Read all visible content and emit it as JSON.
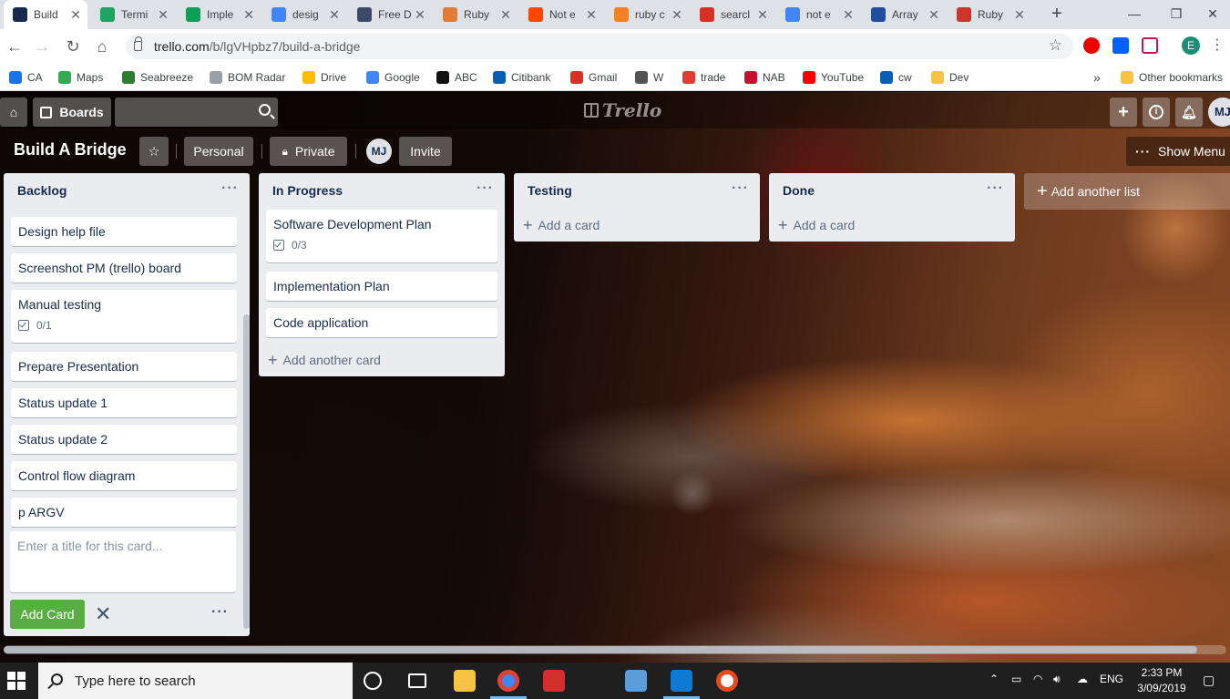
{
  "browser": {
    "tabs": [
      {
        "title": "Build",
        "color": "#172b4d",
        "active": true
      },
      {
        "title": "Termi",
        "color": "#1fa463"
      },
      {
        "title": "Imple",
        "color": "#0f9d58"
      },
      {
        "title": "desig",
        "color": "#4285f4"
      },
      {
        "title": "Free D",
        "color": "#3b4a6b"
      },
      {
        "title": "Ruby",
        "color": "#e07b39"
      },
      {
        "title": "Not e",
        "color": "#ff4500"
      },
      {
        "title": "ruby c",
        "color": "#f48024"
      },
      {
        "title": "searcl",
        "color": "#d93025"
      },
      {
        "title": "not e",
        "color": "#4285f4"
      },
      {
        "title": "Array",
        "color": "#1f4e9c"
      },
      {
        "title": "Ruby",
        "color": "#cc342d"
      }
    ],
    "new_tab": "+",
    "url_domain": "trello.com",
    "url_path": "/b/lgVHpbz7/build-a-bridge",
    "profile_initial": "E",
    "bookmarks": [
      {
        "label": "CA",
        "color": "#1a73e8"
      },
      {
        "label": "Maps",
        "color": "#34a853"
      },
      {
        "label": "Seabreeze",
        "color": "#2e7d32"
      },
      {
        "label": "BOM Radar",
        "color": "#9aa0a6"
      },
      {
        "label": "Drive",
        "color": "#fbbc04"
      },
      {
        "label": "Google",
        "color": "#4285f4"
      },
      {
        "label": "ABC",
        "color": "#111111"
      },
      {
        "label": "Citibank",
        "color": "#0b5fb3"
      },
      {
        "label": "Gmail",
        "color": "#d93025"
      },
      {
        "label": "W",
        "color": "#555555"
      },
      {
        "label": "trade",
        "color": "#e53935"
      },
      {
        "label": "NAB",
        "color": "#c8102e"
      },
      {
        "label": "YouTube",
        "color": "#ff0000"
      },
      {
        "label": "cw",
        "color": "#0b5fb3"
      },
      {
        "label": "Dev",
        "color": "#f6c343"
      }
    ],
    "bookmarks_overflow": "»",
    "other_bookmarks": "Other bookmarks"
  },
  "trello": {
    "boards_label": "Boards",
    "logo_text": "Trello",
    "avatar_initials": "MJ",
    "board_title": "Build A Bridge",
    "team_label": "Personal",
    "visibility_label": "Private",
    "invite_label": "Invite",
    "show_menu_label": "Show Menu",
    "add_list_label": "Add another list",
    "lists": [
      {
        "title": "Backlog",
        "cards": [
          {
            "title": "Design help file"
          },
          {
            "title": "Screenshot PM (trello) board"
          },
          {
            "title": "Manual testing",
            "checklist": "0/1"
          },
          {
            "title": "Prepare Presentation"
          },
          {
            "title": "Status update 1"
          },
          {
            "title": "Status update 2"
          },
          {
            "title": "Control flow diagram"
          },
          {
            "title": "p ARGV"
          }
        ],
        "composer_placeholder": "Enter a title for this card...",
        "add_card_button": "Add Card"
      },
      {
        "title": "In Progress",
        "cards": [
          {
            "title": "Software Development Plan",
            "checklist": "0/3"
          },
          {
            "title": "Implementation Plan"
          },
          {
            "title": "Code application"
          }
        ],
        "add_card_label": "Add another card"
      },
      {
        "title": "Testing",
        "cards": [],
        "add_card_label": "Add a card"
      },
      {
        "title": "Done",
        "cards": [],
        "add_card_label": "Add a card"
      }
    ]
  },
  "taskbar": {
    "search_placeholder": "Type here to search",
    "language": "ENG",
    "time": "2:33 PM",
    "date": "3/09/2019"
  }
}
